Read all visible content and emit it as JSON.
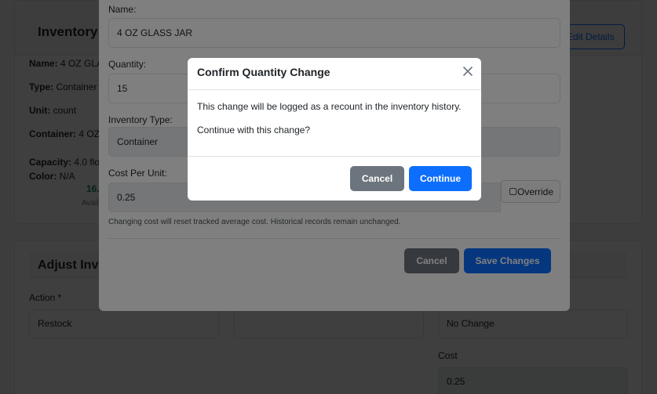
{
  "background": {
    "top_card": {
      "title": "Inventory",
      "edit_button_label": "Edit Details",
      "name_label": "Name:",
      "name_value": "4 OZ GLA",
      "type_label": "Type:",
      "type_value": "Container",
      "unit_label": "Unit:",
      "unit_value": "count",
      "container_label": "Container:",
      "container_value": "4 OZ",
      "capacity_label": "Capacity:",
      "capacity_value": "4.0 flo",
      "color_label": "Color:",
      "color_value": "N/A",
      "available_value": "16.",
      "available_label": "Avail"
    },
    "adjust_card": {
      "title": "Adjust Inve",
      "action_label": "Action *",
      "action_value": "Restock",
      "middle_value": "",
      "right_value": "No Change",
      "cost_label": "Cost",
      "cost_value": "0.25"
    }
  },
  "edit_modal": {
    "name_label": "Name:",
    "name_value": "4 OZ GLASS JAR",
    "quantity_label": "Quantity:",
    "quantity_value": "15",
    "inventory_type_label": "Inventory Type:",
    "inventory_type_value": "Container",
    "cost_per_unit_label": "Cost Per Unit:",
    "cost_per_unit_value": "0.25",
    "override_label": "Override",
    "help_text": "Changing cost will reset tracked average cost. Historical records remain unchanged.",
    "cancel_label": "Cancel",
    "save_label": "Save Changes"
  },
  "confirm_modal": {
    "title": "Confirm Quantity Change",
    "message": "This change will be logged as a recount in the inventory history.",
    "question": "Continue with this change?",
    "cancel_label": "Cancel",
    "continue_label": "Continue",
    "close_icon": "close-icon"
  },
  "colors": {
    "primary": "#0d6efd",
    "secondary": "#6c757d",
    "success": "#198754"
  }
}
